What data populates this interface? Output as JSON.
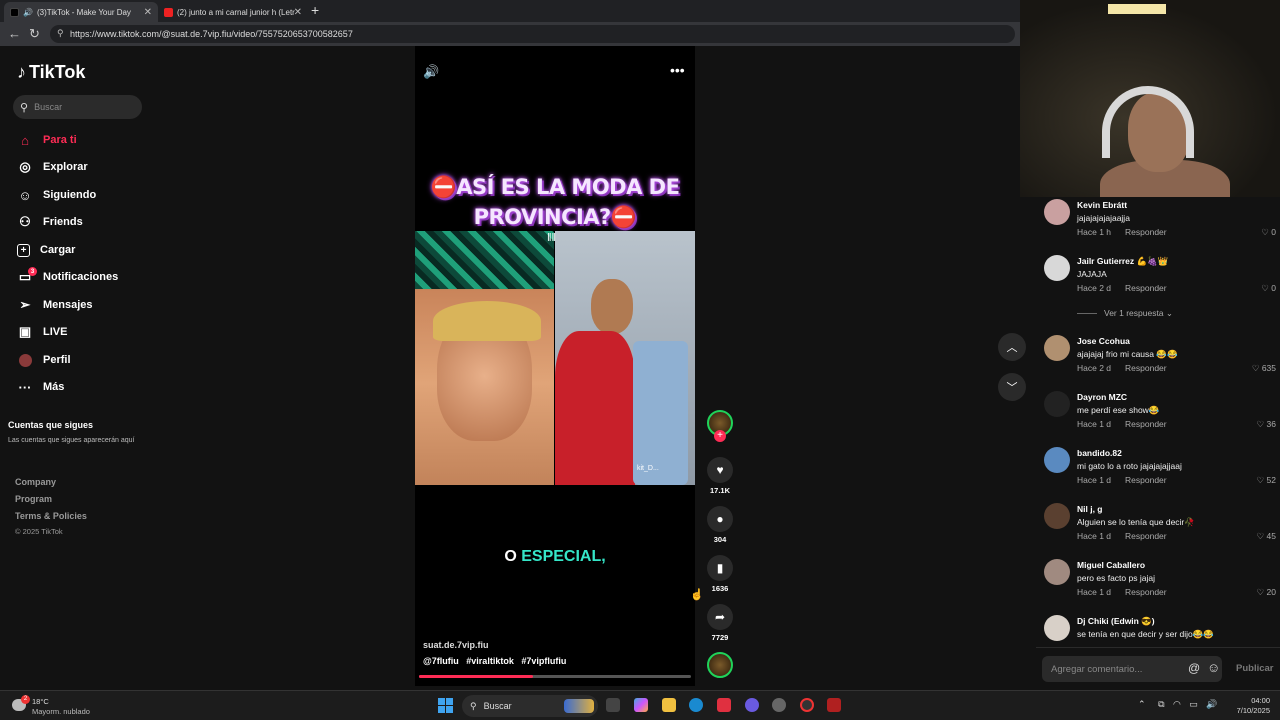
{
  "browser": {
    "tabs": [
      {
        "label": "(3)TikTok - Make Your Day",
        "active": true
      },
      {
        "label": "(2) junto a mi carnal junior h (Letr",
        "active": false
      }
    ],
    "url": "https://www.tiktok.com/@suat.de.7vip.fiu/video/7557520653700582657"
  },
  "sidebar": {
    "logo": "TikTok",
    "search_placeholder": "Buscar",
    "nav": [
      {
        "label": "Para ti",
        "icon": "home-icon",
        "active": true
      },
      {
        "label": "Explorar",
        "icon": "compass-icon"
      },
      {
        "label": "Siguiendo",
        "icon": "following-icon"
      },
      {
        "label": "Friends",
        "icon": "friends-icon"
      },
      {
        "label": "Cargar",
        "icon": "upload-icon"
      },
      {
        "label": "Notificaciones",
        "icon": "notifications-icon",
        "badge": "3"
      },
      {
        "label": "Mensajes",
        "icon": "messages-icon"
      },
      {
        "label": "LIVE",
        "icon": "live-icon"
      },
      {
        "label": "Perfil",
        "icon": "profile-icon"
      },
      {
        "label": "Más",
        "icon": "more-icon"
      }
    ],
    "following_heading": "Cuentas que sigues",
    "following_sub": "Las cuentas que sigues aparecerán aquí",
    "footer_links": [
      "Company",
      "Program",
      "Terms & Policies"
    ],
    "copyright": "© 2025 TikTok"
  },
  "video": {
    "title_line1": "⛔ASÍ ES LA MODA DE",
    "title_line2": "PROVINCIA?⛔",
    "caption_word1": "O",
    "caption_word2": "ESPECIAL,",
    "panel_label": "kit_D...",
    "username": "suat.de.7vip.fiu",
    "hashtags": [
      "@7flufiu",
      "#viraltiktok",
      "#7vipflufiu"
    ],
    "progress": 0.42
  },
  "actions": {
    "likes": "17.1K",
    "comments": "304",
    "saves": "1636",
    "shares": "7729"
  },
  "comments": [
    {
      "name": "Kevin Ebrátt",
      "text": "jajajajajajaajja",
      "time": "Hace 1 h",
      "likes": "0",
      "avatar_color": "#c9a0a0"
    },
    {
      "name": "Jailr Gutierrez 💪🍇👑",
      "text": "JAJAJA",
      "time": "Hace 2 d",
      "likes": "0",
      "avatar_color": "#d8d8d8"
    },
    {
      "name": "Jose Ccohua",
      "text": "ajajajaj frio mi causa 😂😂",
      "time": "Hace 2 d",
      "likes": "635",
      "avatar_color": "#b09070"
    },
    {
      "name": "Dayron MZC",
      "text": "me perdí ese show😂",
      "time": "Hace 1 d",
      "likes": "36",
      "avatar_color": "#222222"
    },
    {
      "name": "bandido.82",
      "text": "mi gato lo a roto jajajajajjaaj",
      "time": "Hace 1 d",
      "likes": "52",
      "avatar_color": "#5a8ac0"
    },
    {
      "name": "Nil j, g",
      "text": "Alguien se lo tenía que decir🥀",
      "time": "Hace 1 d",
      "likes": "45",
      "avatar_color": "#5a4030"
    },
    {
      "name": "Miguel Caballero",
      "text": "pero es facto ps jajaj",
      "time": "Hace 1 d",
      "likes": "20",
      "avatar_color": "#a08a80"
    },
    {
      "name": "Dj Chiki (Edwin 😎)",
      "text": "se tenía en que decir y ser dijo😂😂",
      "time": "",
      "likes": "",
      "avatar_color": "#d8d0c8"
    }
  ],
  "comment_ui": {
    "reply_label": "Responder",
    "view_replies": "Ver 1 respuesta",
    "add_placeholder": "Agregar comentario...",
    "publish": "Publicar"
  },
  "taskbar": {
    "temp": "18°C",
    "weather": "Mayorm. nublado",
    "weather_badge": "2",
    "search": "Buscar",
    "time": "04:00",
    "date": "7/10/2025"
  }
}
